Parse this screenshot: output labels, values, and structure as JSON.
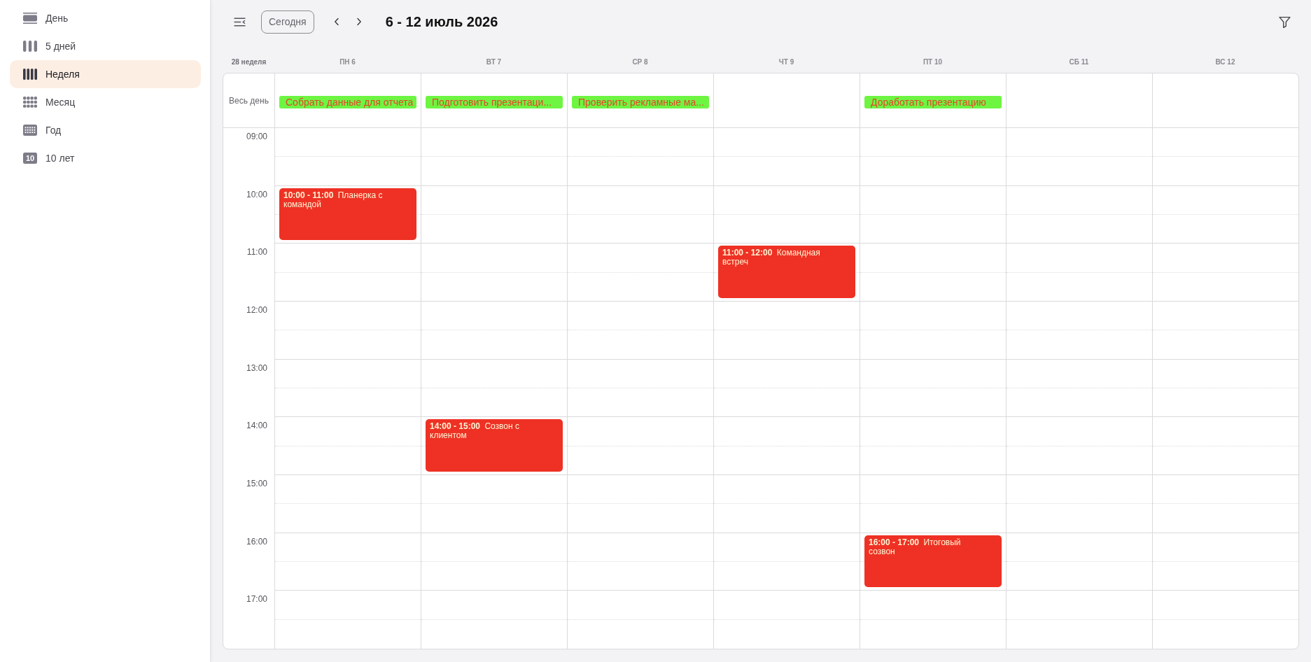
{
  "sidebar": {
    "items": [
      {
        "label": "День",
        "kind": "day",
        "selected": false
      },
      {
        "label": "5 дней",
        "kind": "five_days",
        "selected": false
      },
      {
        "label": "Неделя",
        "kind": "week",
        "selected": true
      },
      {
        "label": "Месяц",
        "kind": "month",
        "selected": false
      },
      {
        "label": "Год",
        "kind": "year",
        "selected": false
      },
      {
        "label": "10 лет",
        "kind": "decade",
        "icon_text": "10",
        "selected": false
      }
    ]
  },
  "toolbar": {
    "today_button": "Сегодня",
    "title": "6 - 12 июль 2026"
  },
  "calendar": {
    "week_label": "28 неделя",
    "all_day_label": "Весь день",
    "hours": [
      "09:00",
      "10:00",
      "11:00",
      "12:00",
      "13:00",
      "14:00",
      "15:00",
      "16:00",
      "17:00"
    ],
    "days": [
      {
        "label": "ПН 6",
        "all_day": [
          {
            "title": "Собрать данные для отчета"
          }
        ],
        "events": [
          {
            "time": "10:00 - 11:00",
            "title": "Планерка с командой"
          }
        ]
      },
      {
        "label": "ВТ 7",
        "all_day": [
          {
            "title": "Подготовить презентаци..."
          }
        ],
        "events": [
          {
            "time": "14:00 - 15:00",
            "title": "Созвон с клиентом"
          }
        ]
      },
      {
        "label": "СР 8",
        "all_day": [
          {
            "title": "Проверить рекламные ма..."
          }
        ]
      },
      {
        "label": "ЧТ 9",
        "events": [
          {
            "time": "11:00 - 12:00",
            "title": "Командная встреч"
          }
        ]
      },
      {
        "label": "ПТ 10",
        "all_day": [
          {
            "title": "Доработать презентацию"
          }
        ],
        "events": [
          {
            "time": "16:00 - 17:00",
            "title": "Итоговый созвон"
          }
        ]
      },
      {
        "label": "СБ 11"
      },
      {
        "label": "ВС 12"
      }
    ]
  }
}
